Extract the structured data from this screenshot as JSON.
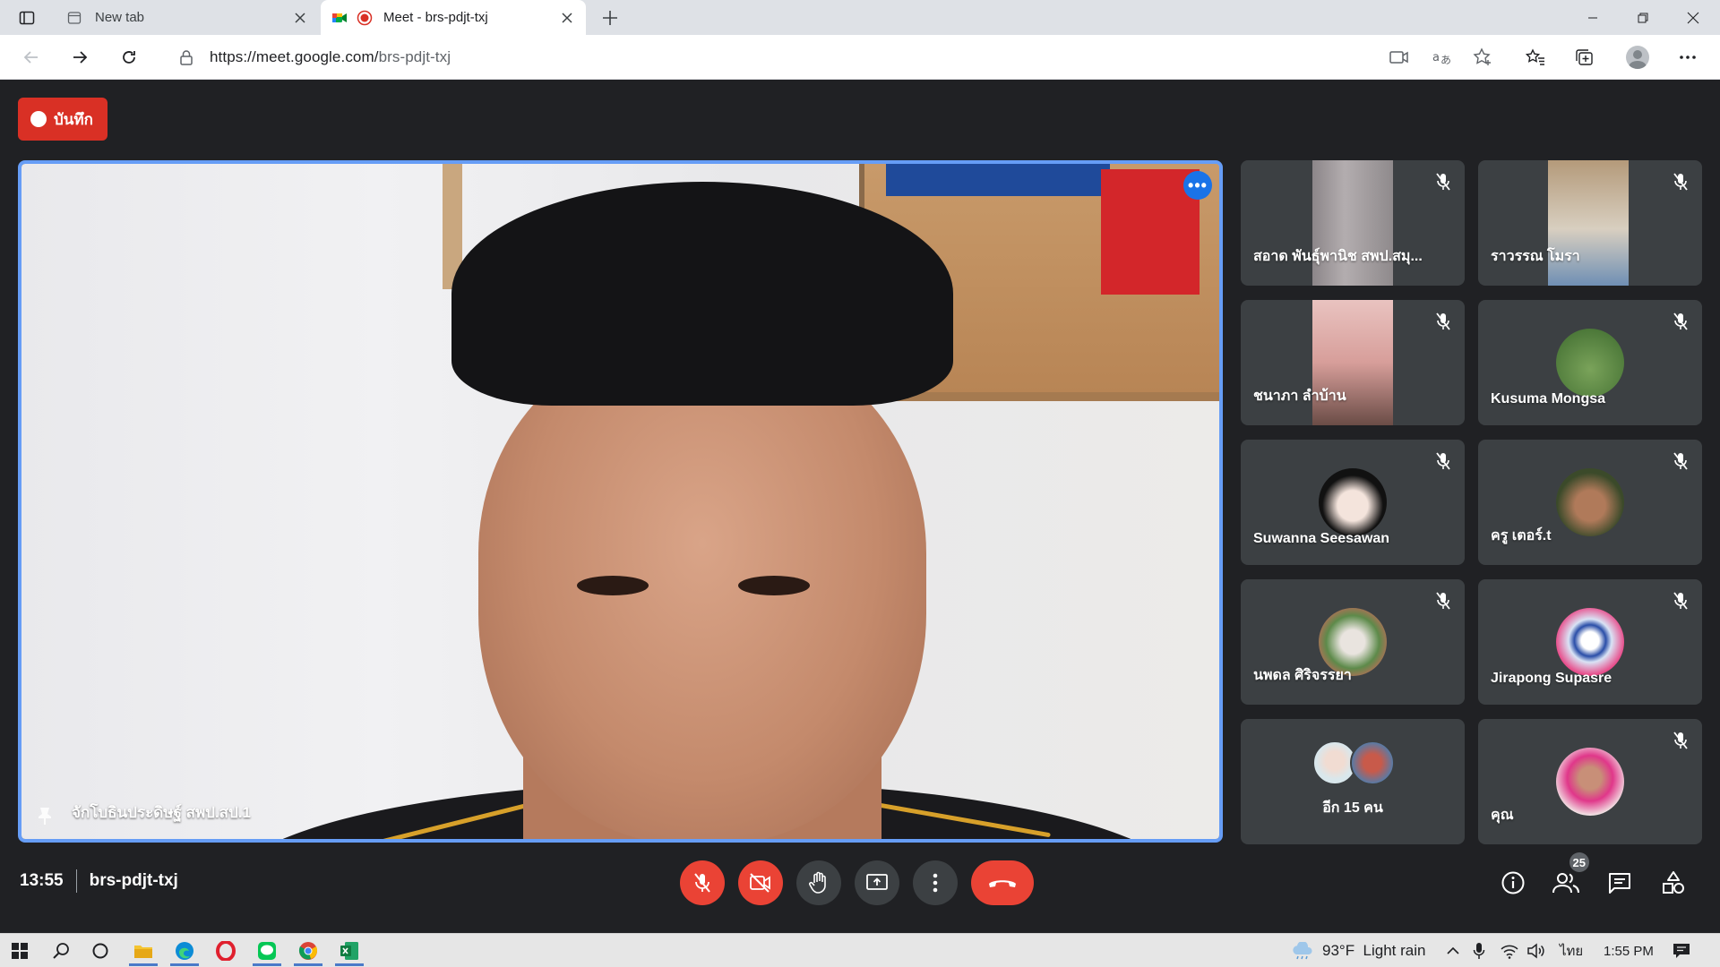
{
  "browser": {
    "tabs": [
      {
        "title": "New tab",
        "active": false
      },
      {
        "title": "Meet - brs-pdjt-txj",
        "active": true
      }
    ],
    "url_host": "https://meet.google.com/",
    "url_path": "brs-pdjt-txj"
  },
  "meet": {
    "record_label": "บันทึก",
    "main_speaker": {
      "name": "จักโบธินประดิษฐ์ สพป.สป.1"
    },
    "tiles": [
      {
        "name": "สอาด พันธุ์พานิช สพป.สมุ...",
        "muted": true,
        "type": "camera"
      },
      {
        "name": "ราวรรณ โมรา",
        "muted": true,
        "type": "camera"
      },
      {
        "name": "ชนาภา ลำบ้าน",
        "muted": true,
        "type": "camera"
      },
      {
        "name": "Kusuma Mongsa",
        "muted": true,
        "type": "avatar"
      },
      {
        "name": "Suwanna Seesawan",
        "muted": true,
        "type": "avatar"
      },
      {
        "name": "ครู เตอร์.t",
        "muted": true,
        "type": "avatar"
      },
      {
        "name": "นพดล ศิริจรรยา",
        "muted": true,
        "type": "avatar"
      },
      {
        "name": "Jirapong Supasre",
        "muted": true,
        "type": "avatar"
      },
      {
        "name": "อีก 15 คน",
        "muted": false,
        "type": "group"
      },
      {
        "name": "คุณ",
        "muted": true,
        "type": "avatar"
      }
    ],
    "bottom": {
      "time": "13:55",
      "meeting_code": "brs-pdjt-txj",
      "participants_count": "25"
    }
  },
  "taskbar": {
    "weather": "93°F  Light rain",
    "language": "ไทย",
    "clock": "1:55 PM"
  },
  "colors": {
    "meet_bg": "#202124",
    "tile_bg": "#3c4043",
    "red": "#ea4335",
    "active_border": "#669df6"
  }
}
